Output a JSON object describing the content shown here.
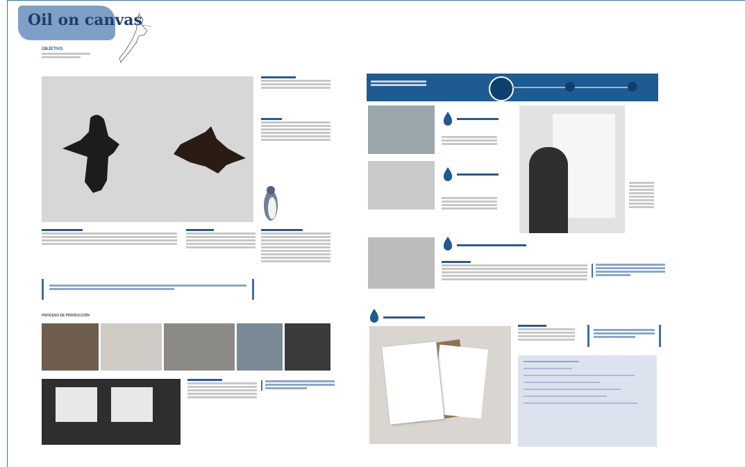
{
  "page_title": "Oil on canvas",
  "left_page": {
    "intro_heading": "OBJETIVO",
    "section_label": "PROCESO DE PRODUCCIÓN"
  },
  "colors": {
    "accent": "#1f5b93",
    "title_splash": "#7e9fc6",
    "panel": "#dde3ee",
    "frame": "#3d6fa0"
  },
  "right_page": {
    "drop_sections": 4,
    "panel_rows": 6
  }
}
